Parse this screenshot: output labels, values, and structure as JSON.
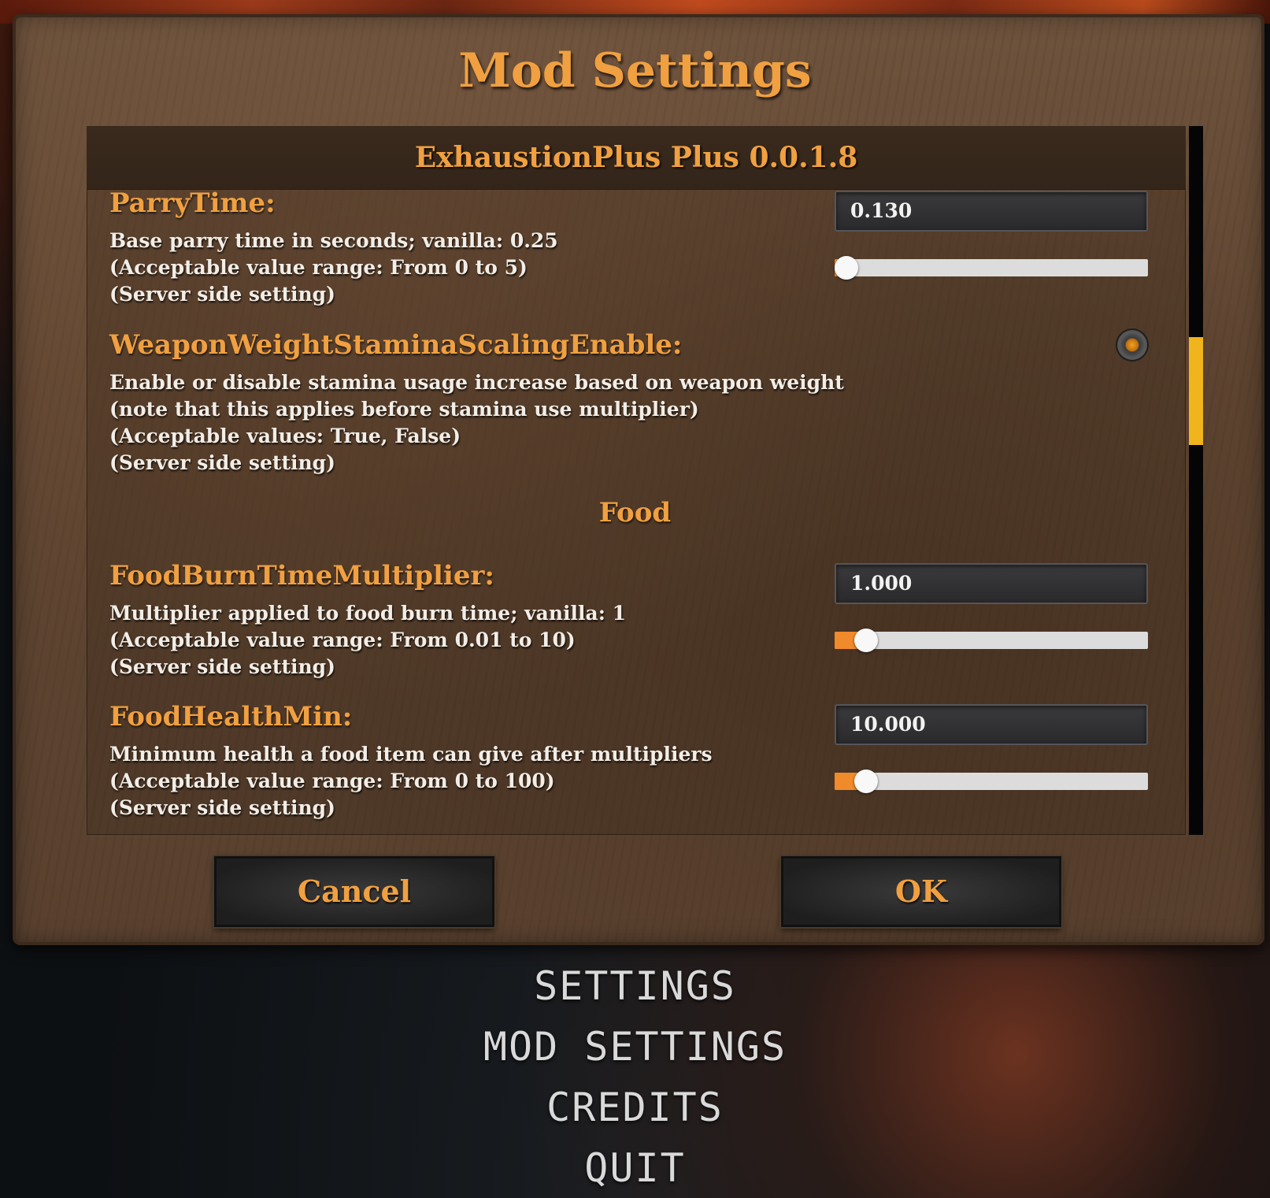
{
  "dialog": {
    "title": "Mod Settings",
    "mod_header": "ExhaustionPlus Plus 0.0.1.8"
  },
  "settings": [
    {
      "name": "ParryTime:",
      "desc": [
        "Base parry time in seconds; vanilla: 0.25",
        "(Acceptable value range: From 0 to 5)",
        "(Server side setting)"
      ],
      "value": "0.130",
      "slider_fraction": 0.026
    },
    {
      "name": "WeaponWeightStaminaScalingEnable:",
      "desc": [
        "Enable or disable stamina usage increase based on weapon weight",
        "(note that this applies before stamina use multiplier)",
        "(Acceptable values: True, False)",
        "(Server side setting)"
      ],
      "toggle_on": true
    },
    {
      "name": "FoodBurnTimeMultiplier:",
      "desc": [
        "Multiplier applied to food burn time; vanilla: 1",
        "(Acceptable value range: From 0.01 to 10)",
        "(Server side setting)"
      ],
      "value": "1.000",
      "slider_fraction": 0.1
    },
    {
      "name": "FoodHealthMin:",
      "desc": [
        "Minimum health a food item can give after multipliers",
        "(Acceptable value range: From 0 to 100)",
        "(Server side setting)"
      ],
      "value": "10.000",
      "slider_fraction": 0.1
    }
  ],
  "section": {
    "food_label": "Food"
  },
  "buttons": {
    "cancel": "Cancel",
    "ok": "OK"
  },
  "main_menu": {
    "items": [
      "SETTINGS",
      "MOD SETTINGS",
      "CREDITS",
      "QUIT"
    ]
  },
  "colors": {
    "accent": "#f0a040",
    "slider_fill": "#f08a2a",
    "scrollbar_thumb": "#f0b41c"
  }
}
